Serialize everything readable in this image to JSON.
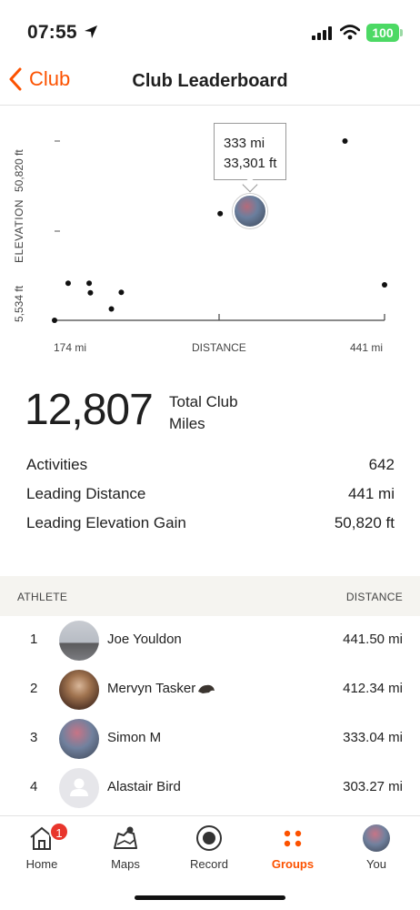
{
  "status_bar": {
    "time": "07:55",
    "battery": "100"
  },
  "nav": {
    "back_label": "Club",
    "title": "Club Leaderboard"
  },
  "chart": {
    "y_top_label": "50,820 ft",
    "y_axis_label": "ELEVATION",
    "y_bottom_label": "5,534 ft",
    "x_left_label": "174 mi",
    "x_axis_label": "DISTANCE",
    "x_right_label": "441 mi",
    "tooltip_distance": "333 mi",
    "tooltip_elevation": "33,301 ft"
  },
  "chart_data": {
    "type": "scatter",
    "xlabel": "DISTANCE",
    "ylabel": "ELEVATION",
    "xlim": [
      174,
      441
    ],
    "ylim": [
      5534,
      50820
    ],
    "points": [
      {
        "x": 174,
        "y": 5534
      },
      {
        "x": 185,
        "y": 14900
      },
      {
        "x": 202,
        "y": 14900
      },
      {
        "x": 203,
        "y": 12500
      },
      {
        "x": 220,
        "y": 8400
      },
      {
        "x": 228,
        "y": 12600
      },
      {
        "x": 308,
        "y": 32500
      },
      {
        "x": 333,
        "y": 33301
      },
      {
        "x": 409,
        "y": 50820
      },
      {
        "x": 441,
        "y": 14500
      }
    ],
    "highlighted": {
      "x": 333,
      "y": 33301
    }
  },
  "totals": {
    "total_miles": "12,807",
    "total_label": "Total Club Miles",
    "stats": [
      {
        "label": "Activities",
        "value": "642"
      },
      {
        "label": "Leading Distance",
        "value": "441 mi"
      },
      {
        "label": "Leading Elevation Gain",
        "value": "50,820 ft"
      }
    ]
  },
  "leaderboard": {
    "col_athlete": "ATHLETE",
    "col_distance": "DISTANCE",
    "rows": [
      {
        "rank": "1",
        "name": "Joe Youldon",
        "distance": "441.50 mi"
      },
      {
        "rank": "2",
        "name": "Mervyn Tasker",
        "distance": "412.34 mi"
      },
      {
        "rank": "3",
        "name": "Simon M",
        "distance": "333.04 mi"
      },
      {
        "rank": "4",
        "name": "Alastair Bird",
        "distance": "303.27 mi"
      }
    ]
  },
  "tabbar": {
    "home": "Home",
    "home_badge": "1",
    "maps": "Maps",
    "record": "Record",
    "groups": "Groups",
    "you": "You",
    "active": "groups",
    "accent_color": "#fc5200"
  }
}
